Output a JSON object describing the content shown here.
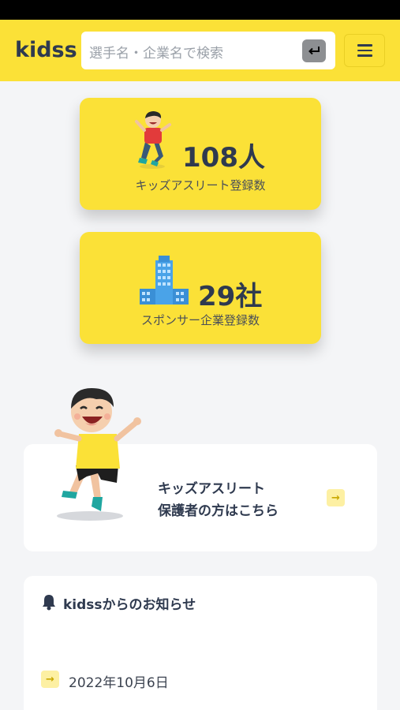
{
  "header": {
    "logo": "kidss",
    "search_placeholder": "選手名・企業名で検索"
  },
  "stats": {
    "athletes": {
      "value": "108人",
      "label": "キッズアスリート登録数"
    },
    "sponsors": {
      "value": "29社",
      "label": "スポンサー企業登録数"
    }
  },
  "parents_link": {
    "line1": "キッズアスリート",
    "line2": "保護者の方はこちら"
  },
  "news": {
    "title": "kidssからのお知らせ",
    "items": [
      {
        "date": "2022年10月6日"
      }
    ]
  },
  "colors": {
    "brand_yellow": "#fbe137",
    "navy": "#2f3a4f",
    "background": "#f4f5f7"
  }
}
